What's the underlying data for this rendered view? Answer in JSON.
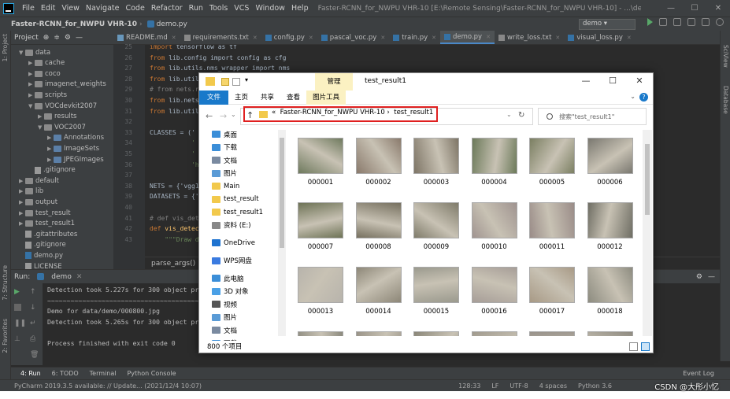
{
  "ide": {
    "menu": [
      "File",
      "Edit",
      "View",
      "Navigate",
      "Code",
      "Refactor",
      "Run",
      "Tools",
      "VCS",
      "Window",
      "Help"
    ],
    "window_title": "Faster-RCNN_for_NWPU VHR-10 [E:\\Remote Sensing\\Faster-RCNN_for_NWPU VHR-10] - ...\\demo.py - PyCharm",
    "project_name": "Faster-RCNN_for_NWPU VHR-10",
    "current_file": "demo.py",
    "run_config": "demo",
    "project_tool": "Project",
    "left_strip": [
      "1: Project",
      "7: Structure",
      "2: Favorites"
    ],
    "right_strip": [
      "SciView",
      "Database"
    ],
    "tree": [
      {
        "label": "data",
        "depth": 0,
        "open": true
      },
      {
        "label": "cache",
        "depth": 1,
        "open": false
      },
      {
        "label": "coco",
        "depth": 1,
        "open": false
      },
      {
        "label": "imagenet_weights",
        "depth": 1,
        "open": false
      },
      {
        "label": "scripts",
        "depth": 1,
        "open": false
      },
      {
        "label": "VOCdevkit2007",
        "depth": 1,
        "open": true
      },
      {
        "label": "results",
        "depth": 2,
        "open": false
      },
      {
        "label": "VOC2007",
        "depth": 2,
        "open": true
      },
      {
        "label": "Annotations",
        "depth": 3,
        "open": false
      },
      {
        "label": "ImageSets",
        "depth": 3,
        "open": false
      },
      {
        "label": "JPEGImages",
        "depth": 3,
        "open": false
      },
      {
        "label": ".gitignore",
        "depth": 1,
        "file": true
      },
      {
        "label": "default",
        "depth": 0,
        "open": false
      },
      {
        "label": "lib",
        "depth": 0,
        "open": false
      },
      {
        "label": "output",
        "depth": 0,
        "open": false
      },
      {
        "label": "test_result",
        "depth": 0,
        "open": false
      },
      {
        "label": "test_result1",
        "depth": 0,
        "open": false
      },
      {
        "label": ".gitattributes",
        "depth": 0,
        "file": true
      },
      {
        "label": ".gitignore",
        "depth": 0,
        "file": true
      },
      {
        "label": "demo.py",
        "depth": 0,
        "file": true,
        "py": true
      },
      {
        "label": "LICENSE",
        "depth": 0,
        "file": true
      }
    ],
    "tabs": [
      {
        "label": "README.md",
        "type": "md"
      },
      {
        "label": "requirements.txt",
        "type": "txt"
      },
      {
        "label": "config.py",
        "type": "py"
      },
      {
        "label": "pascal_voc.py",
        "type": "py"
      },
      {
        "label": "train.py",
        "type": "py"
      },
      {
        "label": "demo.py",
        "type": "py",
        "active": true
      },
      {
        "label": "write_loss.txt",
        "type": "txt"
      },
      {
        "label": "visual_loss.py",
        "type": "py"
      }
    ],
    "line_numbers": [
      "25",
      "26",
      "27",
      "28",
      "29",
      "30",
      "31",
      "32",
      "33",
      "34",
      "35",
      "36",
      "37",
      "38",
      "39",
      "40",
      "41",
      "42",
      "43"
    ],
    "code_lines": [
      {
        "kw": "import ",
        "rest": "tensorflow as tf"
      },
      {
        "kw": "from ",
        "rest": "lib.config import config as cfg"
      },
      {
        "kw": "from ",
        "rest": "lib.utils.nms_wrapper import nms"
      },
      {
        "kw": "from ",
        "rest": "lib.utils"
      },
      {
        "cm": "# from nets.r"
      },
      {
        "kw": "from ",
        "rest": "lib.nets"
      },
      {
        "kw": "from ",
        "rest": "lib.utils"
      },
      {
        "rest": ""
      },
      {
        "rest": "CLASSES = ('"
      },
      {
        "st": "           '"
      },
      {
        "st": "           '"
      },
      {
        "st": "           'h"
      },
      {
        "rest": ""
      },
      {
        "rest": "NETS = {'vgg1"
      },
      {
        "rest": "DATASETS = {'"
      },
      {
        "rest": ""
      },
      {
        "cm": "# def vis_det"
      },
      {
        "kw": "def ",
        "fn": "vis_detec"
      },
      {
        "st": "    \"\"\"Draw d"
      }
    ],
    "code_breadcrumb": "parse_args()",
    "run_tab": "demo",
    "run_label": "Run:",
    "console": [
      "Detection took 5.227s for 300 object pro",
      "~~~~~~~~~~~~~~~~~~~~~~~~~~~~~~~~~~~~~~~~",
      "Demo for data/demo/000800.jpg",
      "Detection took 5.265s for 300 object pro",
      "",
      "Process finished with exit code 0"
    ],
    "bottom_tabs": [
      "4: Run",
      "6: TODO",
      "Terminal",
      "Python Console"
    ],
    "event_log": "Event Log",
    "status_left": "PyCharm 2019.3.5 available: // Update... (2021/12/4 10:07)",
    "status_right": [
      "128:33",
      "LF",
      "UTF-8",
      "4 spaces",
      "Python 3.6"
    ],
    "watermark": "CSDN @大彤小忆"
  },
  "explorer": {
    "manage_tab": "管理",
    "folder_title": "test_result1",
    "ribbon": [
      "文件",
      "主页",
      "共享",
      "查看",
      "图片工具"
    ],
    "window_controls": [
      "—",
      "☐",
      "✕"
    ],
    "address_prefix": "«",
    "address_parts": [
      "Faster-RCNN_for_NWPU VHR-10",
      "test_result1"
    ],
    "search_placeholder": "搜索\"test_result1\"",
    "nav": [
      {
        "label": "桌面",
        "color": "#3b8ed8",
        "pin": true
      },
      {
        "label": "下载",
        "color": "#3b8ed8",
        "pin": true
      },
      {
        "label": "文档",
        "color": "#7a8aa0",
        "pin": true
      },
      {
        "label": "图片",
        "color": "#5a9bd6",
        "pin": true
      },
      {
        "label": "Main",
        "color": "#f2c94c"
      },
      {
        "label": "test_result",
        "color": "#f2c94c"
      },
      {
        "label": "test_result1",
        "color": "#f2c94c"
      },
      {
        "label": "资料 (E:)",
        "color": "#888888"
      },
      {
        "label": "OneDrive",
        "color": "#1e73d0",
        "gap": true
      },
      {
        "label": "WPS网盘",
        "color": "#3a7be0",
        "gap": true
      },
      {
        "label": "此电脑",
        "color": "#3b8ed8",
        "gap": true
      },
      {
        "label": "3D 对象",
        "color": "#4aa0e6"
      },
      {
        "label": "视频",
        "color": "#555555"
      },
      {
        "label": "图片",
        "color": "#5a9bd6"
      },
      {
        "label": "文档",
        "color": "#7a8aa0"
      },
      {
        "label": "下载",
        "color": "#3b8ed8"
      }
    ],
    "files": [
      {
        "name": "000001",
        "tone": "#6f7a5e"
      },
      {
        "name": "000002",
        "tone": "#8a7a6c"
      },
      {
        "name": "000003",
        "tone": "#7e7566"
      },
      {
        "name": "000004",
        "tone": "#6c7a5a"
      },
      {
        "name": "000005",
        "tone": "#7b7f62"
      },
      {
        "name": "000006",
        "tone": "#7a7870"
      },
      {
        "name": "000007",
        "tone": "#6e7356"
      },
      {
        "name": "000008",
        "tone": "#76705f"
      },
      {
        "name": "000009",
        "tone": "#7f7b6a"
      },
      {
        "name": "000010",
        "tone": "#a09490"
      },
      {
        "name": "000011",
        "tone": "#9a8c88"
      },
      {
        "name": "000012",
        "tone": "#6f6e64"
      },
      {
        "name": "000013",
        "tone": "#b8b4ac"
      },
      {
        "name": "000014",
        "tone": "#8d8778"
      },
      {
        "name": "000015",
        "tone": "#9b9a8e"
      },
      {
        "name": "000016",
        "tone": "#a79e98"
      },
      {
        "name": "000017",
        "tone": "#a89a86"
      },
      {
        "name": "000018",
        "tone": "#8d8c80"
      },
      {
        "name": "",
        "tone": "#8c8a7e"
      },
      {
        "name": "",
        "tone": "#9a9488"
      },
      {
        "name": "",
        "tone": "#8a8678"
      },
      {
        "name": "",
        "tone": "#a09a8e"
      },
      {
        "name": "",
        "tone": "#98928a"
      },
      {
        "name": "",
        "tone": "#8e8a80"
      }
    ],
    "item_count": "800 个项目"
  }
}
